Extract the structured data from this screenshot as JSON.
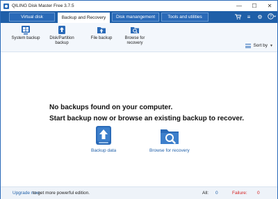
{
  "window": {
    "title": "QILING Disk Master Free 3.7.5",
    "controls": {
      "minimize": "—",
      "maximize": "☐",
      "close": "✕"
    }
  },
  "tabs": [
    {
      "label": "Virtual disk",
      "active": false
    },
    {
      "label": "Backup and Recovery",
      "active": true
    },
    {
      "label": "Disk manangement",
      "active": false
    },
    {
      "label": "Tools and utilities",
      "active": false
    }
  ],
  "tab_icons": {
    "store": "🛒",
    "menu": "≡",
    "settings": "⚙",
    "help": "?"
  },
  "toolbar": {
    "items": [
      {
        "label": "System backup",
        "icon": "windows-icon"
      },
      {
        "label": "Disk/Partition backup",
        "label_line1": "Disk/Partition",
        "label_line2": "backup",
        "icon": "disk-backup-icon"
      },
      {
        "label": "File backup",
        "icon": "folder-backup-icon"
      },
      {
        "label": "Browse for recovery",
        "label_line1": "Browse for",
        "label_line2": "recovery",
        "icon": "search-folder-icon"
      }
    ],
    "sort_by": "Sort by"
  },
  "main": {
    "message_line1": "No backups found on your computer.",
    "message_line2": "Start backup now or browse an existing backup to recover.",
    "backup_data_label": "Backup data",
    "browse_recovery_label": "Browse for recovery"
  },
  "statusbar": {
    "upgrade_link": "Upgrade now",
    "upgrade_text": "to get more powerful edition.",
    "all_label": "All:",
    "all_value": "0",
    "failure_label": "Failure:",
    "failure_value": "0"
  },
  "colors": {
    "accent": "#1f5fa8",
    "failure": "#d42020"
  }
}
